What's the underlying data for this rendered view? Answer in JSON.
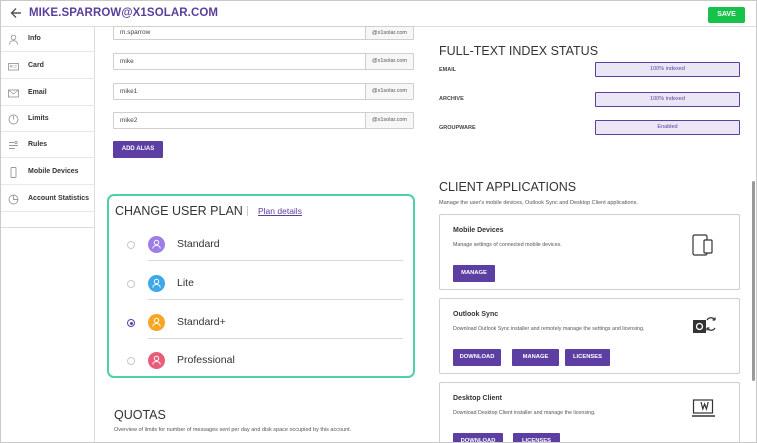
{
  "header": {
    "back_icon": "arrow-left-icon",
    "title": "MIKE.SPARROW@X1SOLAR.COM",
    "save_label": "SAVE",
    "save_color": "#17c24a"
  },
  "sidebar": {
    "items": [
      {
        "label": "Info",
        "icon": "user-icon"
      },
      {
        "label": "Card",
        "icon": "id-card-icon"
      },
      {
        "label": "Email",
        "icon": "envelope-icon"
      },
      {
        "label": "Limits",
        "icon": "gauge-icon"
      },
      {
        "label": "Rules",
        "icon": "rules-icon"
      },
      {
        "label": "Mobile Devices",
        "icon": "mobile-icon"
      },
      {
        "label": "Account Statistics",
        "icon": "stats-icon"
      }
    ]
  },
  "aliases": {
    "rows": [
      {
        "value": "m.sparrow",
        "domain": "@x1solar.com"
      },
      {
        "value": "mike",
        "domain": "@x1solar.com"
      },
      {
        "value": "mike1",
        "domain": "@x1solar.com"
      },
      {
        "value": "mike2",
        "domain": "@x1solar.com"
      }
    ],
    "add_label": "ADD ALIAS"
  },
  "plan": {
    "title": "CHANGE USER PLAN",
    "details_link": "Plan details",
    "options": [
      {
        "name": "Standard",
        "selected": false,
        "color": "#9c7ee6"
      },
      {
        "name": "Lite",
        "selected": false,
        "color": "#3ea8e8"
      },
      {
        "name": "Standard+",
        "selected": true,
        "color": "#f5a623"
      },
      {
        "name": "Professional",
        "selected": false,
        "color": "#e85d7a"
      }
    ]
  },
  "quotas": {
    "title": "QUOTAS",
    "description": "Overview of limits for number of messages sent per day and disk space occupied by this account."
  },
  "fti": {
    "title": "FULL-TEXT INDEX STATUS",
    "rows": [
      {
        "label": "EMAIL",
        "status": "100% indexed"
      },
      {
        "label": "ARCHIVE",
        "status": "100% indexed"
      },
      {
        "label": "GROUPWARE",
        "status": "Enabled"
      }
    ]
  },
  "client_apps": {
    "title": "CLIENT APPLICATIONS",
    "description": "Manage the user's mobile devices, Outlook Sync and Desktop Client applications.",
    "cards": [
      {
        "title": "Mobile Devices",
        "description": "Manage settings of connected mobile devices.",
        "icon": "tablet-phone-icon",
        "buttons": [
          "MANAGE"
        ]
      },
      {
        "title": "Outlook Sync",
        "description": "Download Outlook Sync installer and remotely manage the settings and licensing.",
        "icon": "outlook-sync-icon",
        "buttons": [
          "DOWNLOAD",
          "MANAGE",
          "LICENSES"
        ]
      },
      {
        "title": "Desktop Client",
        "description": "Download Desktop Client installer and manage the licensing.",
        "icon": "desktop-client-icon",
        "buttons": [
          "DOWNLOAD",
          "LICENSES"
        ]
      }
    ]
  },
  "accent_color": "#5d3fa3"
}
